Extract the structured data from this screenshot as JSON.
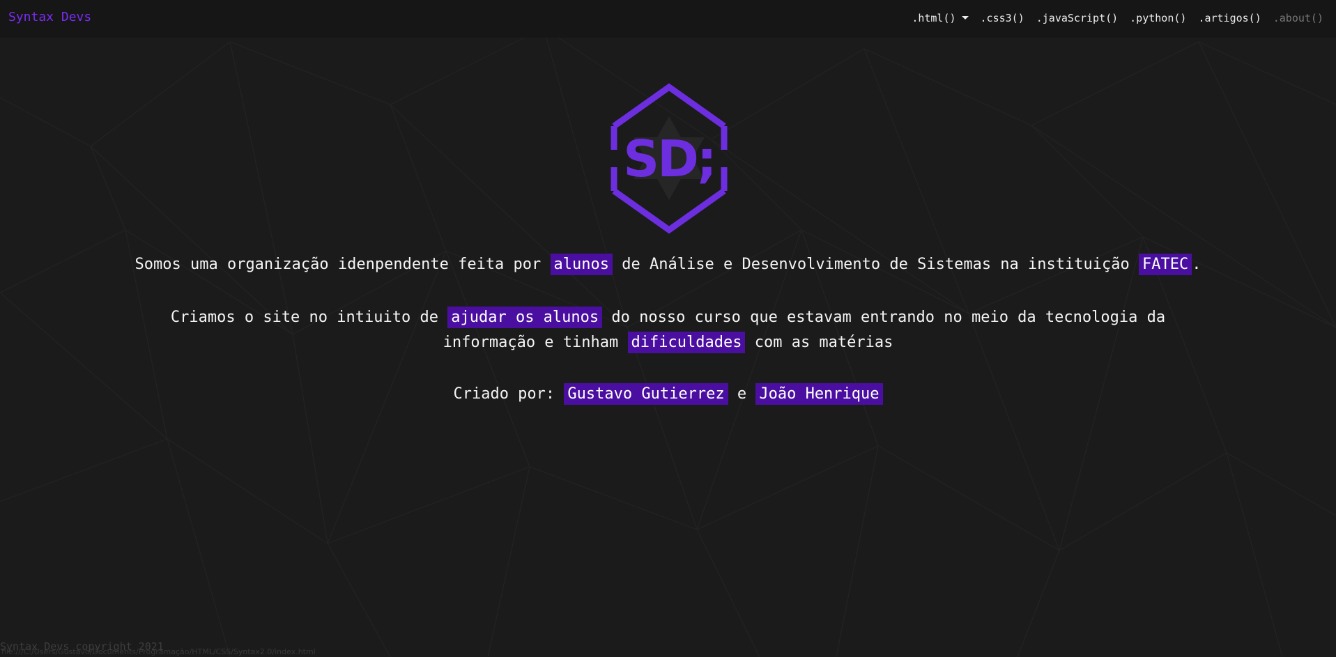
{
  "colors": {
    "background": "#1b1b1b",
    "navbar": "#161616",
    "accent": "#7b2cf5",
    "highlight": "#4a0fa0",
    "logo": "#6d2ee0"
  },
  "navbar": {
    "brand": "Syntax Devs",
    "links": [
      {
        "label": ".html()",
        "has_dropdown": true,
        "icon": "caret-down-icon"
      },
      {
        "label": ".css3()"
      },
      {
        "label": ".javaScript()"
      },
      {
        "label": ".python()"
      },
      {
        "label": ".artigos()"
      },
      {
        "label": ".about()",
        "active": true
      }
    ]
  },
  "logo": {
    "text": "SD;",
    "icon": "hexagon-logo-icon"
  },
  "about": {
    "p1": {
      "a": "Somos uma organização idenpendente feita por ",
      "h1": "alunos",
      "b": " de Análise e Desenvolvimento de Sistemas na instituição ",
      "h2": "FATEC",
      "c": "."
    },
    "p2": {
      "a": "Criamos o site no intiuito de ",
      "h1": "ajudar os alunos",
      "b": " do nosso curso que estavam entrando no meio da tecnologia da",
      "c": "informação e tinham ",
      "h2": "dificuldades",
      "d": " com as matérias"
    },
    "p3": {
      "a": "Criado por: ",
      "h1": "Gustavo Gutierrez",
      "b": " e ",
      "h2": "João Henrique"
    }
  },
  "footer": {
    "copyright": "Syntax Devs copyright 2021"
  },
  "status_bar": {
    "url": "file:///C:/Users/Gustavo/Documents/Programação/HTML/CSS/Syntax2.0/index.html"
  }
}
